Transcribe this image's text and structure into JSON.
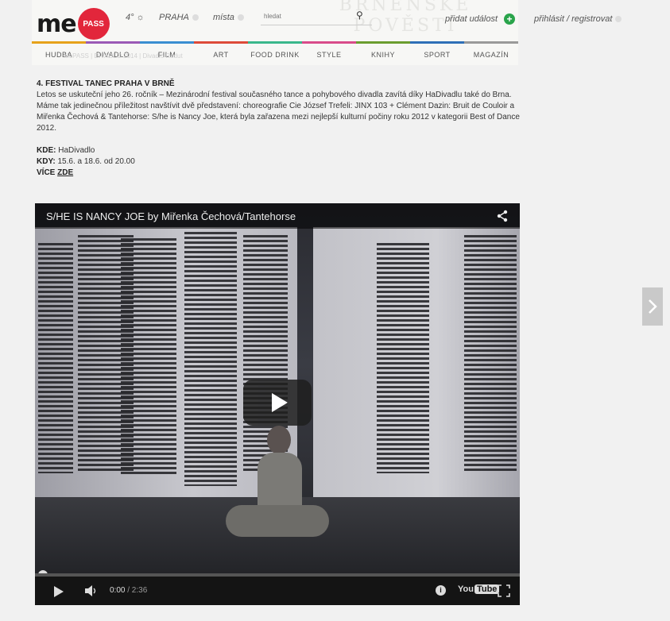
{
  "header": {
    "logo_text": "me",
    "logo_badge": "PASS",
    "weather": "4°",
    "city": "PRAHA",
    "places": "místa",
    "search_placeholder": "hledat",
    "add_event": "přidat událost",
    "login": "přihlásit / registrovat",
    "bg_text_1": "BRNĚNSKÉ",
    "bg_text_2": "POVĚSTI",
    "overlay_text": "MePASS | DIVADLO 2014 | Divadlo Redut"
  },
  "nav": {
    "items": [
      "HUDBA",
      "DIVADLO",
      "FILM",
      "ART",
      "FOOD DRINK",
      "STYLE",
      "KNIHY",
      "SPORT",
      "MAGAZÍN"
    ]
  },
  "article": {
    "title": "4. FESTIVAL TANEC PRAHA V BRNĚ",
    "body": "Letos se uskuteční jeho 26. ročník – Mezinárodní festival současného tance a pohybového divadla zavítá díky HaDivadlu také do Brna. Máme tak jedinečnou příležitost navštívit dvě představení: choreografie Cie József Trefeli: JINX 103 + Clément Dazin: Bruit de Couloir a Miřenka Čechová & Tantehorse: S/he is Nancy Joe, která byla zařazena mezi nejlepší kulturní počiny roku 2012 v kategorii Best of Dance 2012.",
    "where_label": "KDE:",
    "where_value": "HaDivadlo",
    "when_label": "KDY:",
    "when_value": "15.6. a 18.6. od 20.00",
    "more_label": "VÍCE",
    "more_link": "ZDE"
  },
  "video": {
    "title": "S/HE IS NANCY JOE by Miřenka Čechová/Tantehorse",
    "current_time": "0:00",
    "duration": "/ 2:36",
    "yt_you": "You",
    "yt_tube": "Tube"
  },
  "colors": {
    "accent_red": "#e2263b",
    "add_green": "#2aa44b"
  }
}
